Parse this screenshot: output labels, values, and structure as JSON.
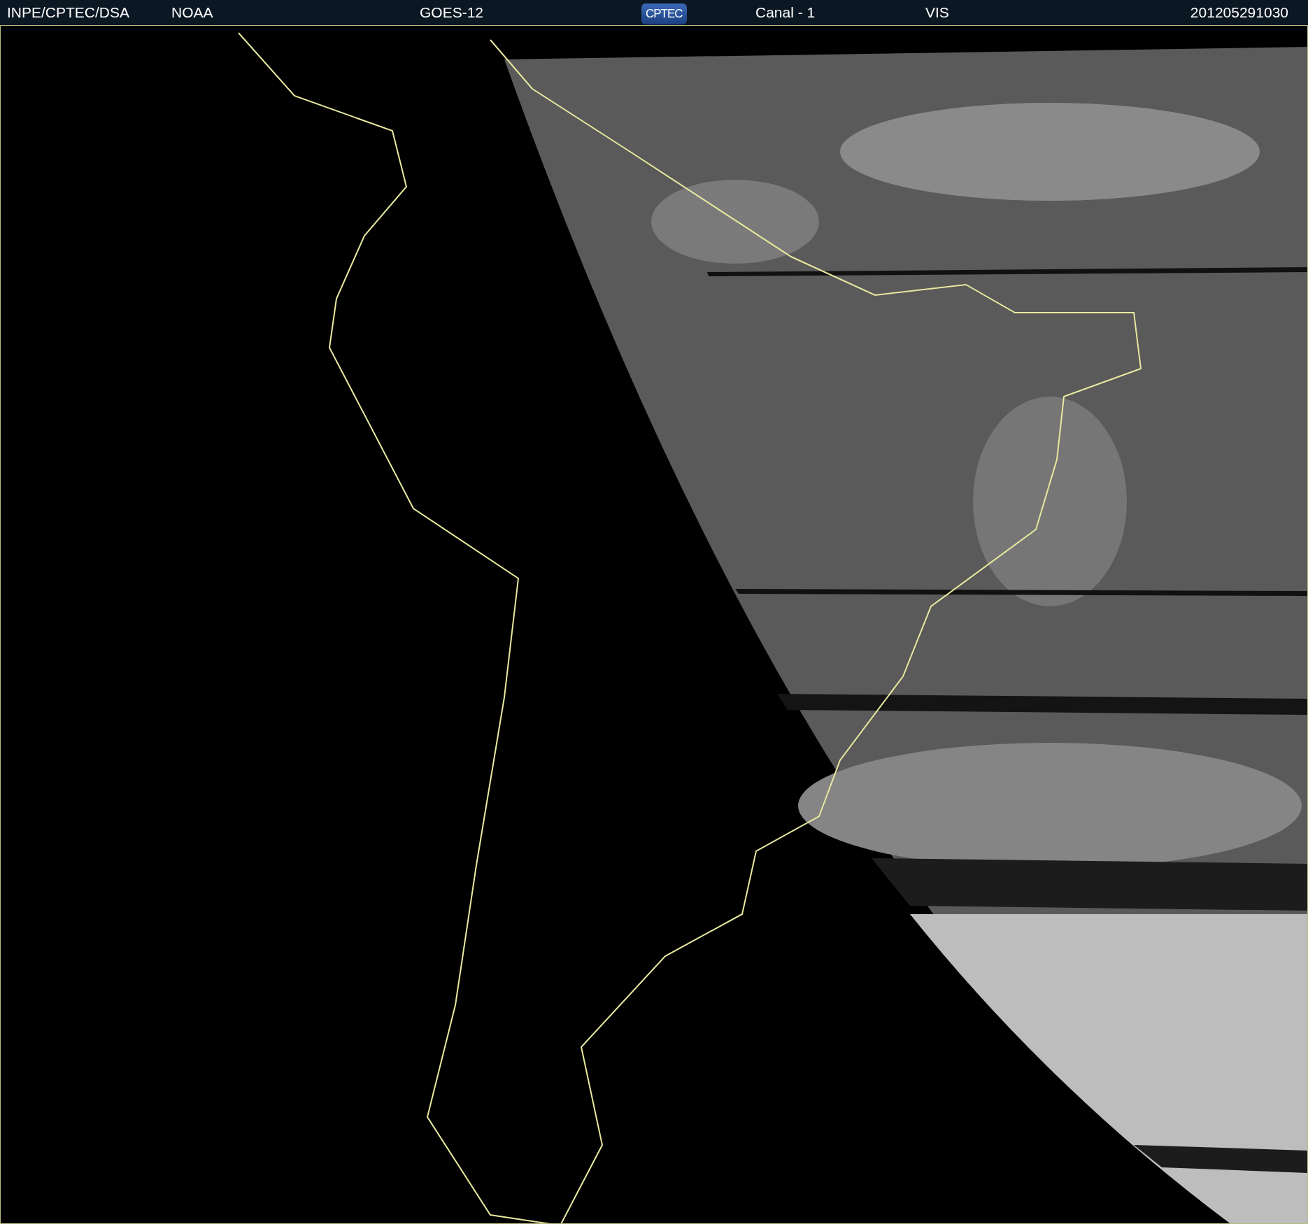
{
  "header": {
    "items": [
      {
        "text": "INPE/CPTEC/DSA",
        "kind": "text"
      },
      {
        "text": "NOAA",
        "kind": "text"
      },
      {
        "text": "GOES-12",
        "kind": "text"
      },
      {
        "text": "CPTEC",
        "kind": "logo"
      },
      {
        "text": "Canal - 1",
        "kind": "text"
      },
      {
        "text": "VIS",
        "kind": "text"
      },
      {
        "text": "201205291030",
        "kind": "text"
      }
    ]
  }
}
